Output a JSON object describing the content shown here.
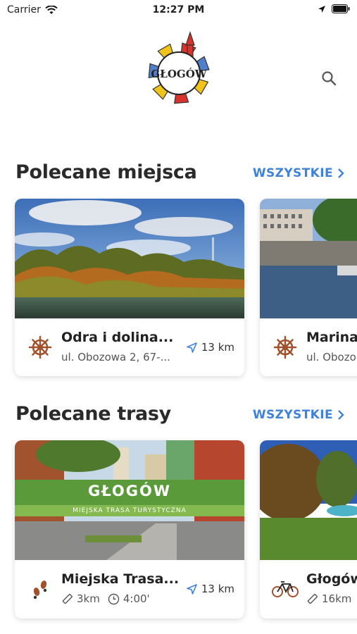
{
  "status_bar": {
    "carrier": "Carrier",
    "time": "12:27 PM"
  },
  "header": {
    "logo_text": "GŁOGÓW",
    "search_icon": "search-icon"
  },
  "places_section": {
    "title": "Polecane miejsca",
    "see_all": "WSZYSTKIE",
    "cards": [
      {
        "title": "Odra i dolina...",
        "address": "ul. Obozowa 2, 67-...",
        "distance": "13 km",
        "icon": "ship-wheel-icon"
      },
      {
        "title": "Marina",
        "address": "ul. Obozo",
        "icon": "ship-wheel-icon"
      }
    ]
  },
  "routes_section": {
    "title": "Polecane trasy",
    "see_all": "WSZYSTKIE",
    "cards": [
      {
        "title": "Miejska Trasa...",
        "length": "3km",
        "duration": "4:00'",
        "distance": "13 km",
        "banner_title": "GŁOGÓW",
        "banner_sub": "MIEJSKA TRASA TURYSTYCZNA",
        "icon": "footprints-icon"
      },
      {
        "title": "Głogów",
        "length": "16km",
        "icon": "bicycle-icon"
      }
    ]
  },
  "colors": {
    "accent": "#3f82d9",
    "banner_green": "#5b9a3a",
    "icon_brown": "#a0522d"
  }
}
